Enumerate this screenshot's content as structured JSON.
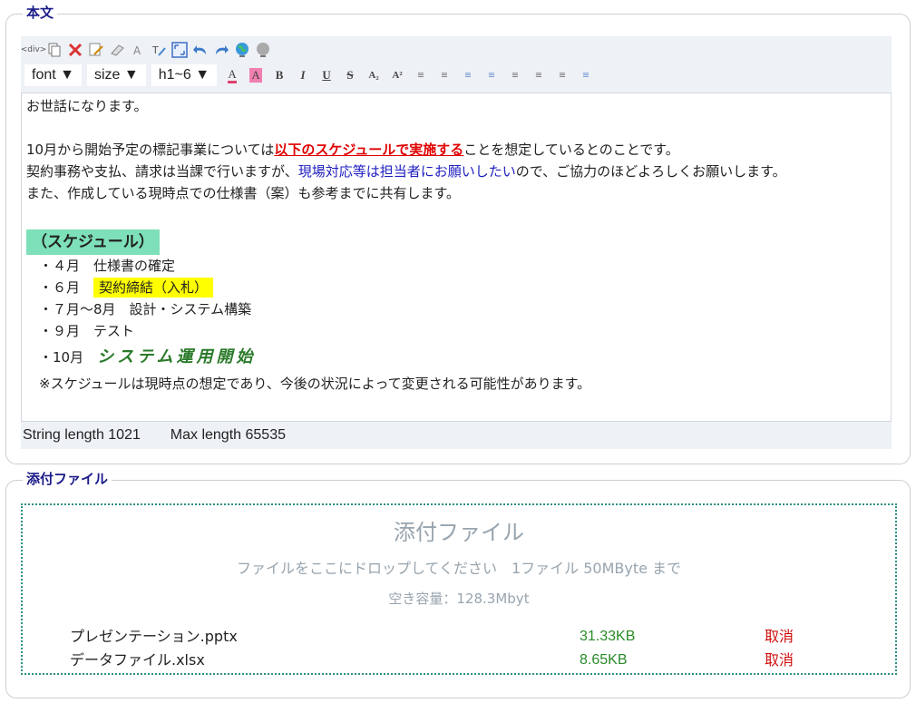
{
  "body_section": {
    "legend": "本文",
    "toolbar": {
      "row1_icons": [
        "div-icon",
        "copy-icon",
        "cut-icon",
        "edit-icon",
        "eraser-icon",
        "clear-format-icon",
        "spell-icon",
        "fullscreen-icon",
        "undo-icon",
        "redo-icon",
        "globe-icon",
        "globe-disabled-icon"
      ],
      "font_label": "font ▼",
      "size_label": "size ▼",
      "heading_label": "h1~6 ▼",
      "format_buttons": [
        "A",
        "A",
        "B",
        "I",
        "U",
        "S",
        "A₂",
        "A²",
        "≡",
        "≡",
        "≡",
        "≡",
        "≡",
        "≡",
        "≡",
        "≡"
      ]
    },
    "editor": {
      "greeting": "お世話になります。",
      "line1_pre": "10月から開始予定の標記事業については",
      "line1_emph": "以下のスケジュールで実施する",
      "line1_post": "ことを想定しているとのことです。",
      "line2_pre": "契約事務や支払、請求は当課で行いますが、",
      "line2_blue": "現場対応等は担当者にお願いしたい",
      "line2_post": "ので、ご協力のほどよろしくお願いします。",
      "line3": "また、作成している現時点での仕様書（案）も参考までに共有します。",
      "schedule_heading": "（スケジュール）",
      "item1": "・４月　仕様書の確定",
      "item2_pre": "・６月　",
      "item2_hl": "契約締結（入札）",
      "item3": "・７月～8月　設計・システム構築",
      "item4": "・９月　テスト",
      "item5_pre": "・10月　",
      "item5_brush": "システム運用開始",
      "note": "※スケジュールは現時点の想定であり、今後の状況によって変更される可能性があります。"
    },
    "status": {
      "string_length": "String length 1021",
      "max_length": "Max length 65535"
    }
  },
  "attach_section": {
    "legend": "添付ファイル",
    "dropzone_title": "添付ファイル",
    "dropzone_hint": "ファイルをここにドロップしてください　1ファイル 50MByte まで",
    "free_space": "空き容量：128.3Mbyt",
    "files": [
      {
        "name": "プレゼンテーション.pptx",
        "size": "31.33KB",
        "cancel": "取消"
      },
      {
        "name": "データファイル.xlsx",
        "size": "8.65KB",
        "cancel": "取消"
      }
    ]
  },
  "colors": {
    "legend": "#1a1a8a",
    "emphasis_red": "#e00000",
    "link_blue": "#2020c0",
    "schedule_bg": "#7de0b8",
    "highlight_yellow": "#ffff00",
    "size_green": "#2a8a2a",
    "cancel_red": "#d01010",
    "dropzone_border": "#2e9080"
  }
}
